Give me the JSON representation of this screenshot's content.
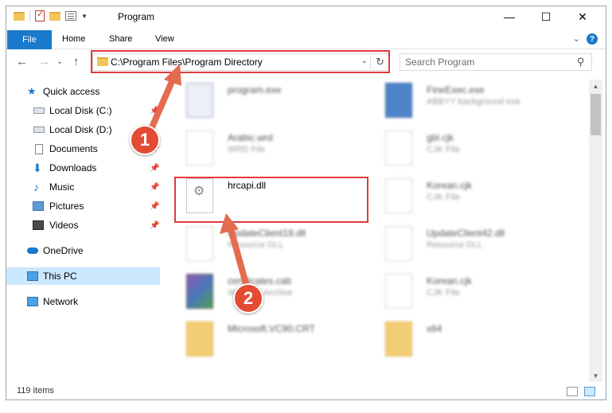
{
  "window": {
    "title": "Program",
    "controls": {
      "minimize": "—",
      "maximize": "☐",
      "close": "✕"
    }
  },
  "ribbon": {
    "file": "File",
    "tabs": [
      "Home",
      "Share",
      "View"
    ]
  },
  "navigation": {
    "address": "C:\\Program Files\\Program Directory",
    "search_placeholder": "Search Program"
  },
  "sidebar": {
    "items": [
      {
        "label": "Quick access",
        "icon": "star-icon"
      },
      {
        "label": "Local Disk (C:)",
        "icon": "disk-icon",
        "pinned": true
      },
      {
        "label": "Local Disk (D:)",
        "icon": "disk-icon"
      },
      {
        "label": "Documents",
        "icon": "documents-icon",
        "pinned": true
      },
      {
        "label": "Downloads",
        "icon": "downloads-icon",
        "pinned": true
      },
      {
        "label": "Music",
        "icon": "music-icon",
        "pinned": true
      },
      {
        "label": "Pictures",
        "icon": "pictures-icon",
        "pinned": true
      },
      {
        "label": "Videos",
        "icon": "videos-icon",
        "pinned": true
      },
      {
        "label": "OneDrive",
        "icon": "onedrive-icon"
      },
      {
        "label": "This PC",
        "icon": "this-pc-icon",
        "selected": true
      },
      {
        "label": "Network",
        "icon": "network-icon"
      }
    ]
  },
  "files": [
    {
      "name": "program.exe",
      "type": "",
      "icon": "exe-icon"
    },
    {
      "name": "FineExec.exe",
      "type": "ABBYY background exe",
      "icon": "app-icon"
    },
    {
      "name": "Arabic.wrd",
      "type": "WRD File",
      "icon": "file-icon"
    },
    {
      "name": "gbl.cjk",
      "type": "CJK File",
      "icon": "file-icon"
    },
    {
      "name": "hrcapi.dll",
      "type": "",
      "icon": "dll-gear-icon"
    },
    {
      "name": "Korean.cjk",
      "type": "CJK File",
      "icon": "file-icon"
    },
    {
      "name": "UpdateClient19.dll",
      "type": "Resource DLL",
      "icon": "dll-gear-icon"
    },
    {
      "name": "UpdateClient42.dll",
      "type": "Resource DLL",
      "icon": "dll-gear-icon"
    },
    {
      "name": "certificates.cab",
      "type": "WinRAR Archive",
      "icon": "archive-icon"
    },
    {
      "name": "Korean.cjk",
      "type": "CJK File",
      "icon": "file-icon"
    },
    {
      "name": "Microsoft.VC90.CRT",
      "type": "",
      "icon": "folder-icon"
    },
    {
      "name": "x64",
      "type": "",
      "icon": "folder-icon"
    }
  ],
  "status": {
    "items": "119 items"
  },
  "annotations": {
    "step1": "1",
    "step2": "2",
    "accent_color": "#e03a3a",
    "arrow_color": "#e46b50"
  }
}
